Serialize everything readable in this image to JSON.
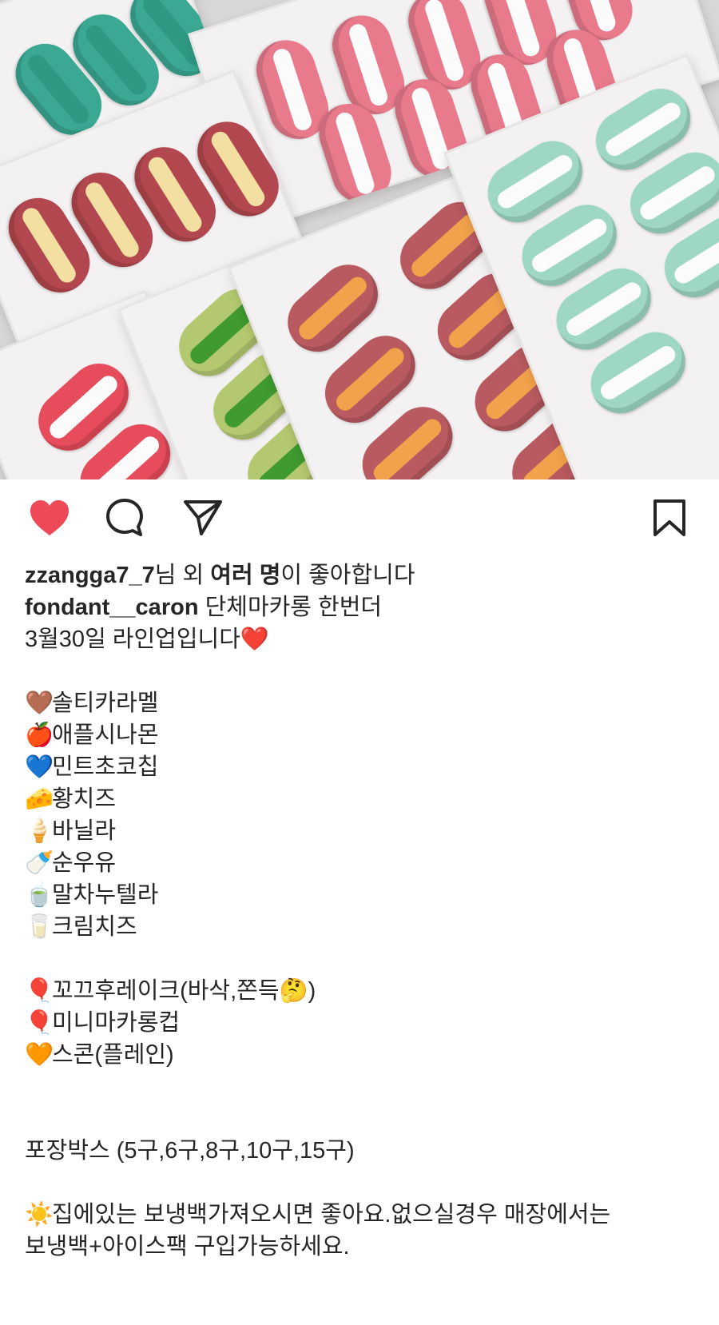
{
  "post": {
    "image": {
      "description": "macaron-boxes-photo",
      "colors": {
        "teal": "#3aa892",
        "pink": "#e87a8c",
        "maroon": "#b3474f",
        "cream": "#f3dfa2",
        "green": "#8cc06a",
        "orange": "#f2a24a",
        "mint": "#9ed8c5",
        "red": "#e64c5b",
        "white": "#fbfbfb"
      }
    },
    "actions": {
      "like_icon": "heart-icon",
      "comment_icon": "comment-icon",
      "share_icon": "paper-plane-icon",
      "save_icon": "bookmark-icon",
      "like_color": "#ed4956"
    },
    "likes": {
      "username": "zzangga7_7",
      "text_1": "님 외 ",
      "bold_others": "여러 명",
      "text_2": "이 좋아합니다"
    },
    "caption": {
      "username": "fondant__caron",
      "first_line": " 단체마카롱 한번더",
      "lines": [
        {
          "emoji": "",
          "text": "3월30일 라인업입니다❤️"
        },
        {
          "emoji": "",
          "text": ""
        },
        {
          "emoji": "🤎",
          "text": "솔티카라멜"
        },
        {
          "emoji": "🍎",
          "text": "애플시나몬"
        },
        {
          "emoji": "💙",
          "text": "민트초코칩"
        },
        {
          "emoji": "🧀",
          "text": "황치즈"
        },
        {
          "emoji": "🍦",
          "text": "바닐라"
        },
        {
          "emoji": "🍼",
          "text": "순우유"
        },
        {
          "emoji": "🍵",
          "text": "말차누텔라"
        },
        {
          "emoji": "🥛",
          "text": "크림치즈"
        },
        {
          "emoji": "",
          "text": ""
        },
        {
          "emoji": "🎈",
          "text": "꼬끄후레이크(바삭,쫀득🤔)"
        },
        {
          "emoji": "🎈",
          "text": "미니마카롱컵"
        },
        {
          "emoji": "🧡",
          "text": "스콘(플레인)"
        },
        {
          "emoji": "",
          "text": ""
        },
        {
          "emoji": "",
          "text": ""
        },
        {
          "emoji": "",
          "text": "포장박스 (5구,6구,8구,10구,15구)"
        },
        {
          "emoji": "",
          "text": ""
        },
        {
          "emoji": "☀️",
          "text": "집에있는 보냉백가져오시면 좋아요.없으실경우 매장에서는"
        },
        {
          "emoji": "",
          "text": "보냉백+아이스팩 구입가능하세요."
        }
      ]
    }
  }
}
